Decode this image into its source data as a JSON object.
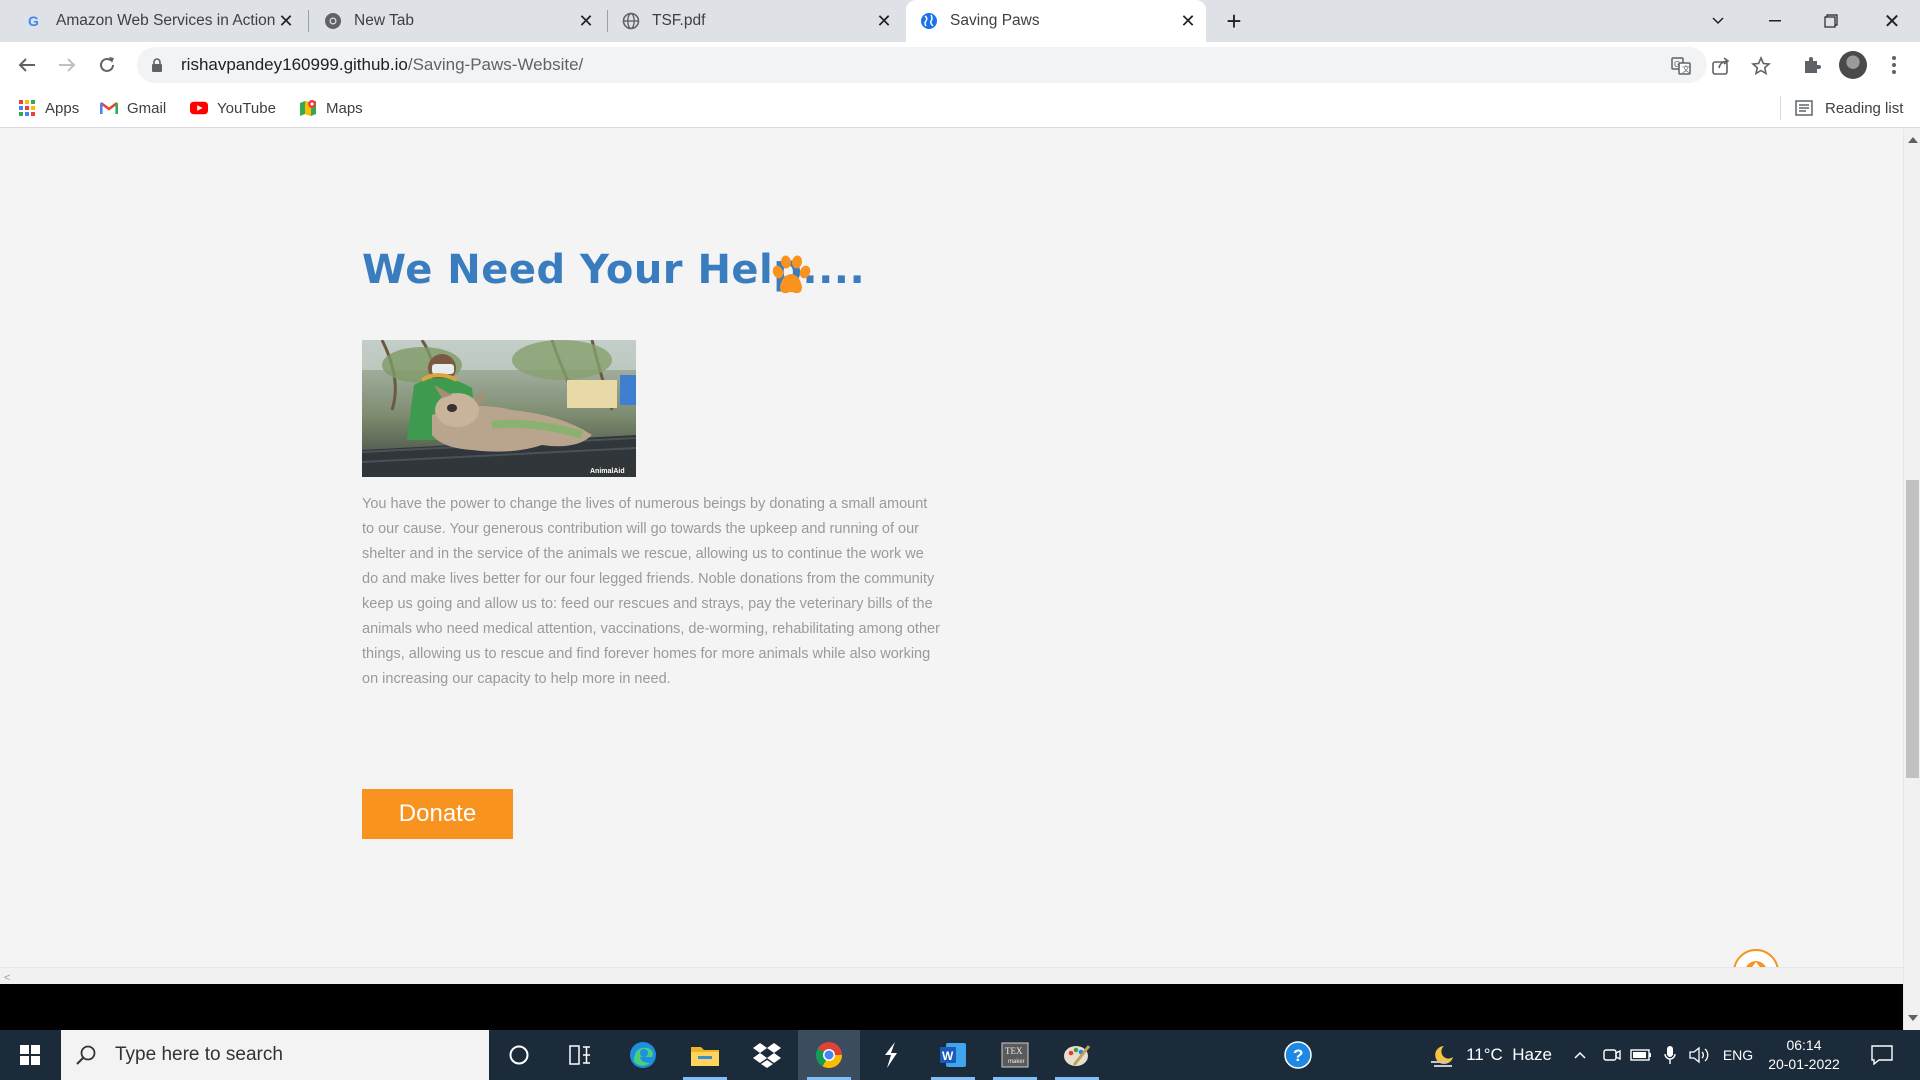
{
  "browser": {
    "tabs": [
      {
        "title": "Amazon Web Services in Action -",
        "favicon": "google-g-icon",
        "active": false
      },
      {
        "title": "New Tab",
        "favicon": "chrome-icon",
        "active": false
      },
      {
        "title": "TSF.pdf",
        "favicon": "globe-icon",
        "active": false
      },
      {
        "title": "Saving Paws",
        "favicon": "globe-icon",
        "active": true
      }
    ],
    "address": {
      "host": "rishavpandey160999.github.io",
      "path": "/Saving-Paws-Website/"
    },
    "bookmarks": [
      {
        "label": "Apps",
        "icon": "apps-grid-icon"
      },
      {
        "label": "Gmail",
        "icon": "gmail-icon"
      },
      {
        "label": "YouTube",
        "icon": "youtube-icon"
      },
      {
        "label": "Maps",
        "icon": "maps-icon"
      }
    ],
    "reading_list": "Reading list"
  },
  "page": {
    "title": "We Need Your Help....",
    "body_text": "You have the power to change the lives of numerous beings by donating a small amount to our cause. Your generous contribution will go towards the upkeep and running of our shelter and in the service of the animals we rescue, allowing us to continue the work we do and make lives better for our four legged friends. Noble donations from the community keep us going and allow us to: feed our rescues and strays, pay the veterinary bills of the animals who need medical attention, vaccinations, de-worming, rehabilitating among other things, allowing us to rescue and find forever homes for more animals while also working on increasing our capacity to help more in need.",
    "photo_watermark": "AnimalAid",
    "donate_label": "Donate",
    "accent_color": "#f7931e",
    "title_color": "#3a7dbf"
  },
  "taskbar": {
    "search_placeholder": "Type here to search",
    "weather": "11°C  Haze",
    "language": "ENG",
    "time": "06:14",
    "date": "20-01-2022"
  }
}
